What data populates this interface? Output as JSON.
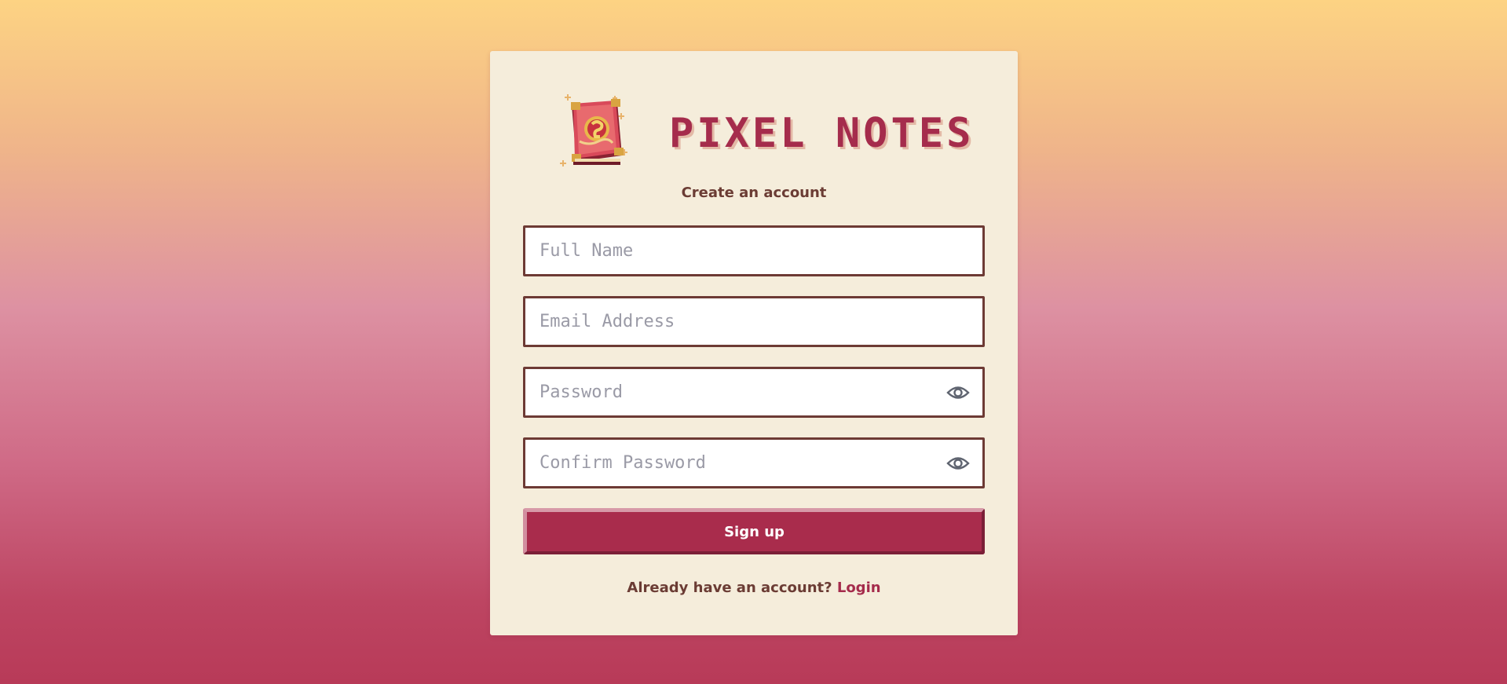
{
  "app": {
    "title": "PIXEL NOTES",
    "subtitle": "Create an account",
    "logo_icon": "spellbook-icon",
    "accent_color": "#a92c4c",
    "text_color": "#6b3c34"
  },
  "form": {
    "full_name": {
      "placeholder": "Full Name",
      "value": ""
    },
    "email": {
      "placeholder": "Email Address",
      "value": ""
    },
    "password": {
      "placeholder": "Password",
      "value": "",
      "toggle_icon": "eye-icon"
    },
    "confirm_password": {
      "placeholder": "Confirm Password",
      "value": "",
      "toggle_icon": "eye-icon"
    },
    "submit_label": "Sign up"
  },
  "footer": {
    "prompt": "Already have an account?",
    "login_link": "Login"
  }
}
